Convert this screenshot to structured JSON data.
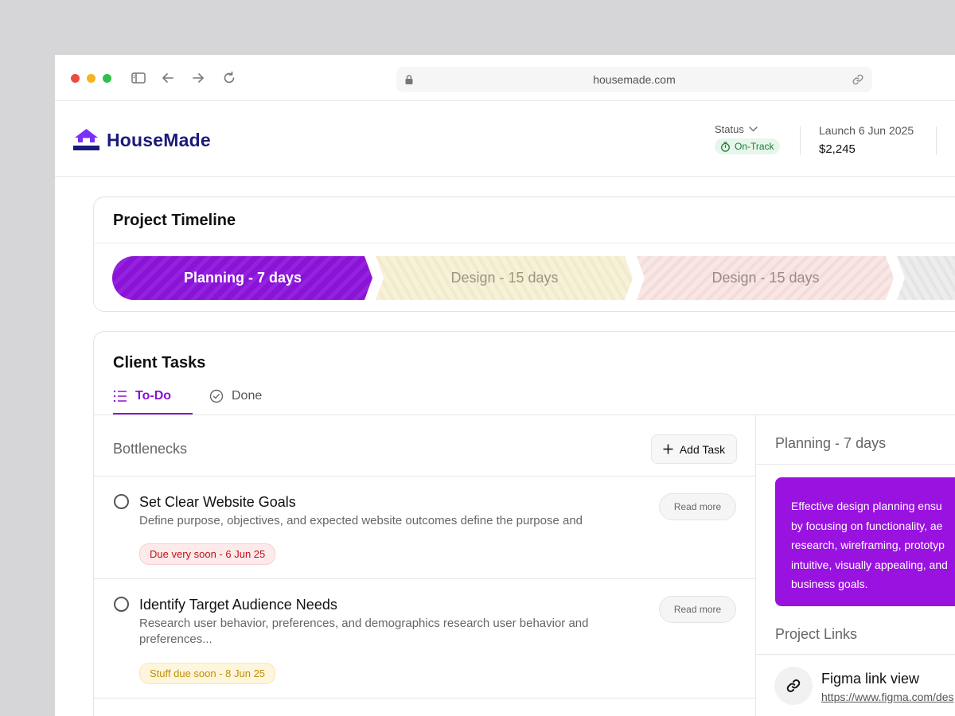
{
  "browser": {
    "url": "housemade.com"
  },
  "header": {
    "logo_text": "HouseMade",
    "status_label": "Status",
    "status_badge": "On-Track",
    "launch_label": "Launch 6 Jun 2025",
    "launch_amount": "$2,245"
  },
  "timeline": {
    "title": "Project Timeline",
    "phases": [
      {
        "label": "Planning - 7 days",
        "color": "#8a13d6",
        "text_color": "#ffffff"
      },
      {
        "label": "Design - 15 days",
        "color": "#f4efd6",
        "text_color": "#9c9580"
      },
      {
        "label": "Design - 15 days",
        "color": "#f7e4e2",
        "text_color": "#9a8a88"
      },
      {
        "label": "",
        "color": "#ececec",
        "text_color": "#999999"
      }
    ]
  },
  "tasks": {
    "title": "Client Tasks",
    "tabs": [
      {
        "label": "To-Do",
        "active": true
      },
      {
        "label": "Done",
        "active": false
      }
    ],
    "section_label": "Bottlenecks",
    "add_task_label": "Add Task",
    "items": [
      {
        "title": "Set Clear Website Goals",
        "description": "Define purpose, objectives, and expected website outcomes define the purpose and",
        "due": "Due very soon - 6 Jun 25",
        "due_color": "red",
        "read_more": "Read more"
      },
      {
        "title": "Identify Target Audience Needs",
        "description": "Research user behavior, preferences, and demographics research user behavior and preferences...",
        "due": "Stuff due soon - 8 Jun 25",
        "due_color": "yellow",
        "read_more": "Read more"
      }
    ]
  },
  "details": {
    "phase_title": "Planning - 7 days",
    "phase_description": "Effective design planning ensu\nby focusing on functionality, ae\nresearch, wireframing, prototyp\nintuitive, visually appealing, and\nbusiness goals.",
    "links_title": "Project Links",
    "link_name": "Figma link view",
    "link_url": "https://www.figma.com/des"
  },
  "colors": {
    "accent": "#8a13d6",
    "brand": "#1b1a7a",
    "logo_purple": "#7b2ff7",
    "ontrack_green": "#1c7a35"
  }
}
